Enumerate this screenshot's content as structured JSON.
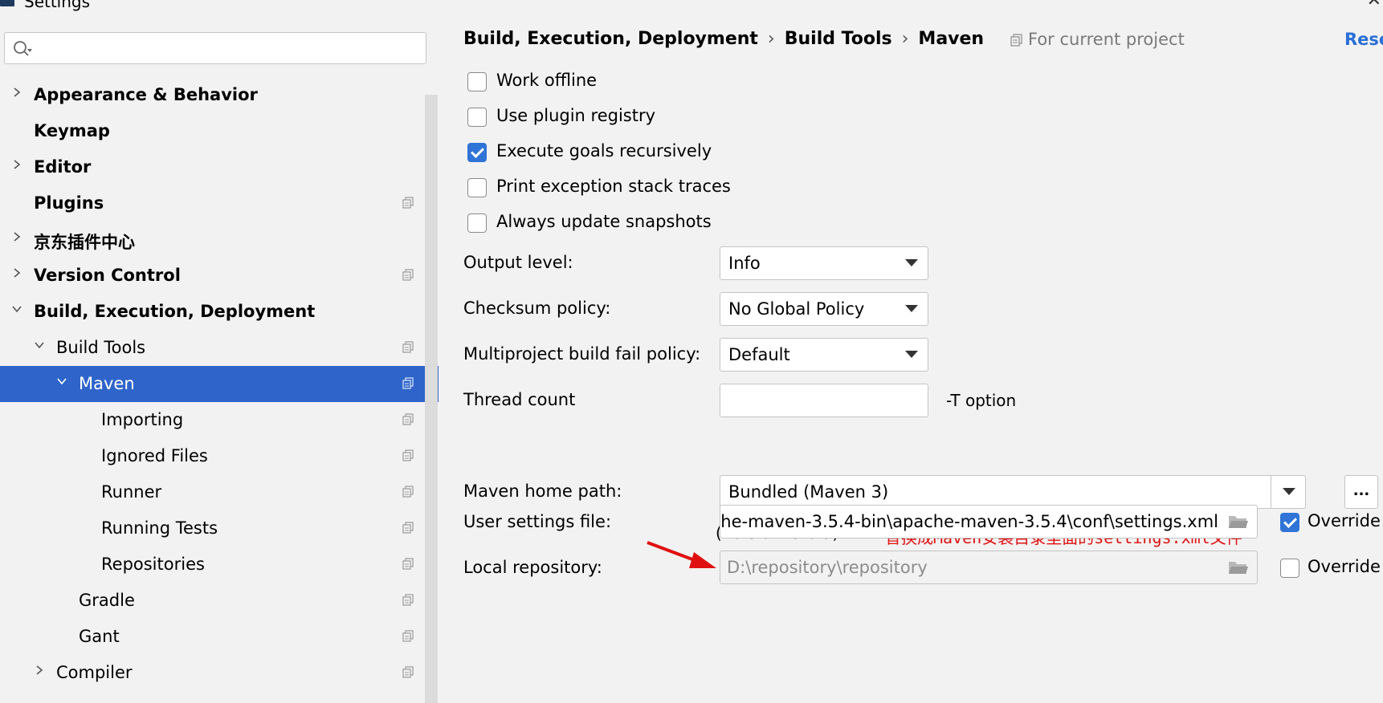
{
  "window": {
    "title": "Settings"
  },
  "sidebar": {
    "search_placeholder": "",
    "items": [
      {
        "label": "Appearance & Behavior",
        "bold": true,
        "chevron": "right",
        "indent": 0,
        "project_icon": false,
        "selected": false
      },
      {
        "label": "Keymap",
        "bold": true,
        "chevron": "none",
        "indent": 0,
        "project_icon": false,
        "selected": false
      },
      {
        "label": "Editor",
        "bold": true,
        "chevron": "right",
        "indent": 0,
        "project_icon": false,
        "selected": false
      },
      {
        "label": "Plugins",
        "bold": true,
        "chevron": "none",
        "indent": 0,
        "project_icon": true,
        "selected": false
      },
      {
        "label": "京东插件中心",
        "bold": true,
        "chevron": "right",
        "indent": 0,
        "project_icon": false,
        "selected": false
      },
      {
        "label": "Version Control",
        "bold": true,
        "chevron": "right",
        "indent": 0,
        "project_icon": true,
        "selected": false
      },
      {
        "label": "Build, Execution, Deployment",
        "bold": true,
        "chevron": "down",
        "indent": 0,
        "project_icon": false,
        "selected": false
      },
      {
        "label": "Build Tools",
        "bold": false,
        "chevron": "down",
        "indent": 1,
        "project_icon": true,
        "selected": false
      },
      {
        "label": "Maven",
        "bold": false,
        "chevron": "down",
        "indent": 2,
        "project_icon": true,
        "selected": true
      },
      {
        "label": "Importing",
        "bold": false,
        "chevron": "none",
        "indent": 3,
        "project_icon": true,
        "selected": false
      },
      {
        "label": "Ignored Files",
        "bold": false,
        "chevron": "none",
        "indent": 3,
        "project_icon": true,
        "selected": false
      },
      {
        "label": "Runner",
        "bold": false,
        "chevron": "none",
        "indent": 3,
        "project_icon": true,
        "selected": false
      },
      {
        "label": "Running Tests",
        "bold": false,
        "chevron": "none",
        "indent": 3,
        "project_icon": true,
        "selected": false
      },
      {
        "label": "Repositories",
        "bold": false,
        "chevron": "none",
        "indent": 3,
        "project_icon": true,
        "selected": false
      },
      {
        "label": "Gradle",
        "bold": false,
        "chevron": "none",
        "indent": 2,
        "project_icon": true,
        "selected": false
      },
      {
        "label": "Gant",
        "bold": false,
        "chevron": "none",
        "indent": 2,
        "project_icon": true,
        "selected": false
      },
      {
        "label": "Compiler",
        "bold": false,
        "chevron": "right",
        "indent": 1,
        "project_icon": true,
        "selected": false
      }
    ]
  },
  "header": {
    "breadcrumb": [
      "Build, Execution, Deployment",
      "Build Tools",
      "Maven"
    ],
    "separator": "›",
    "scope_label": "For current project",
    "reset_label": "Rese"
  },
  "options": {
    "work_offline": {
      "label": "Work offline",
      "checked": false
    },
    "use_plugin_registry": {
      "label": "Use plugin registry",
      "checked": false
    },
    "execute_goals_recursively": {
      "label": "Execute goals recursively",
      "checked": true
    },
    "print_exception_stack_traces": {
      "label": "Print exception stack traces",
      "checked": false
    },
    "always_update_snapshots": {
      "label": "Always update snapshots",
      "checked": false
    }
  },
  "form": {
    "output_level": {
      "label": "Output level:",
      "value": "Info"
    },
    "checksum_policy": {
      "label": "Checksum policy:",
      "value": "No Global Policy"
    },
    "multiproject_fail_policy": {
      "label": "Multiproject build fail policy:",
      "value": "Default"
    },
    "thread_count": {
      "label": "Thread count",
      "value": "",
      "hint": "-T option"
    },
    "maven_home": {
      "label": "Maven home path:",
      "value": "Bundled (Maven 3)",
      "browse_label": "...",
      "version": "(Version: 3.6.3)"
    },
    "user_settings": {
      "label": "User settings file:",
      "value": ":he-maven-3.5.4-bin\\apache-maven-3.5.4\\conf\\settings.xml",
      "override_label": "Override",
      "override_checked": true
    },
    "local_repository": {
      "label": "Local repository:",
      "value": "D:\\repository\\repository",
      "override_label": "Override",
      "override_checked": false
    }
  },
  "annotation": {
    "text": "替换成Maven安装目录里面的settings.xml文件",
    "color": "#e01010"
  },
  "colors": {
    "selection": "#2f65ca",
    "checkbox_checked": "#2f74d6",
    "link": "#2a6fd6"
  }
}
